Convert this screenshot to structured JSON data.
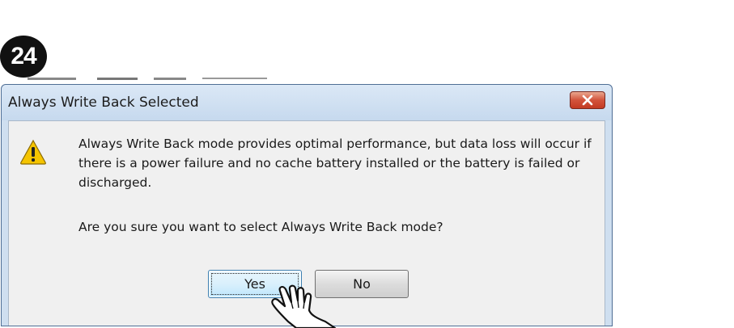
{
  "step": {
    "number": "24"
  },
  "dialog": {
    "title": "Always Write Back Selected",
    "close_icon": "close-x-icon",
    "warning_icon": "warning-triangle-icon",
    "message": "Always Write Back mode provides optimal performance, but data loss will occur if there is a power failure and no cache battery installed or the battery is failed or discharged.",
    "question": "Are you sure you want to select Always Write Back mode?",
    "buttons": {
      "yes": "Yes",
      "no": "No"
    }
  },
  "cursor": {
    "icon": "hand-pointer-icon"
  },
  "colors": {
    "title_bar": "#cfdff0",
    "close_button": "#c33a22",
    "warning_yellow": "#f5c400",
    "default_button_border": "#3c7fb1"
  }
}
